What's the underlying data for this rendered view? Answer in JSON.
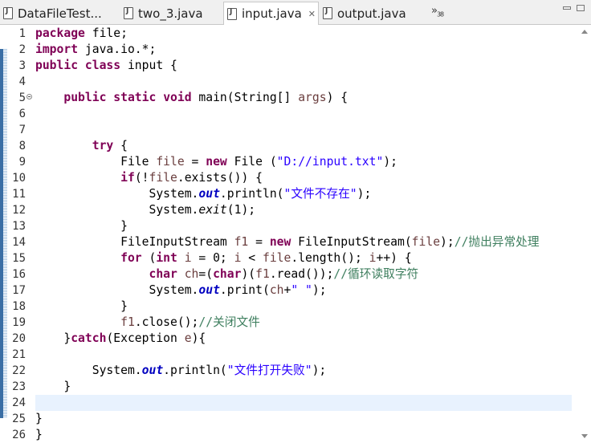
{
  "tabs": [
    {
      "label": "DataFileTest...",
      "active": false
    },
    {
      "label": "two_3.java",
      "active": false
    },
    {
      "label": "input.java",
      "active": true
    },
    {
      "label": "output.java",
      "active": false
    }
  ],
  "overflow": {
    "symbol": "»",
    "count": "38"
  },
  "code_lines": [
    {
      "num": "1",
      "tokens": [
        {
          "t": "package",
          "c": "kw"
        },
        {
          "t": " file;"
        }
      ]
    },
    {
      "num": "2",
      "tokens": [
        {
          "t": "import",
          "c": "kw"
        },
        {
          "t": " java.io.*;"
        }
      ]
    },
    {
      "num": "3",
      "tokens": [
        {
          "t": "public",
          "c": "kw"
        },
        {
          "t": " "
        },
        {
          "t": "class",
          "c": "kw"
        },
        {
          "t": " input {"
        }
      ]
    },
    {
      "num": "4",
      "tokens": []
    },
    {
      "num": "5",
      "fold": true,
      "tokens": [
        {
          "t": "    "
        },
        {
          "t": "public",
          "c": "kw"
        },
        {
          "t": " "
        },
        {
          "t": "static",
          "c": "kw"
        },
        {
          "t": " "
        },
        {
          "t": "void",
          "c": "kw"
        },
        {
          "t": " main(String[] "
        },
        {
          "t": "args",
          "c": "var"
        },
        {
          "t": ") {"
        }
      ]
    },
    {
      "num": "6",
      "tokens": []
    },
    {
      "num": "7",
      "tokens": []
    },
    {
      "num": "8",
      "tokens": [
        {
          "t": "        "
        },
        {
          "t": "try",
          "c": "kw"
        },
        {
          "t": " {"
        }
      ]
    },
    {
      "num": "9",
      "tokens": [
        {
          "t": "            File "
        },
        {
          "t": "file",
          "c": "var"
        },
        {
          "t": " = "
        },
        {
          "t": "new",
          "c": "kw"
        },
        {
          "t": " File ("
        },
        {
          "t": "\"D://input.txt\"",
          "c": "str"
        },
        {
          "t": ");"
        }
      ]
    },
    {
      "num": "10",
      "tokens": [
        {
          "t": "            "
        },
        {
          "t": "if",
          "c": "kw"
        },
        {
          "t": "(!"
        },
        {
          "t": "file",
          "c": "var"
        },
        {
          "t": ".exists()) {"
        }
      ]
    },
    {
      "num": "11",
      "tokens": [
        {
          "t": "                System."
        },
        {
          "t": "out",
          "c": "fld"
        },
        {
          "t": ".println("
        },
        {
          "t": "\"文件不存在\"",
          "c": "str"
        },
        {
          "t": ");"
        }
      ]
    },
    {
      "num": "12",
      "tokens": [
        {
          "t": "                System."
        },
        {
          "t": "exit",
          "c": "ital"
        },
        {
          "t": "(1);"
        }
      ]
    },
    {
      "num": "13",
      "tokens": [
        {
          "t": "            }"
        }
      ]
    },
    {
      "num": "14",
      "tokens": [
        {
          "t": "            FileInputStream "
        },
        {
          "t": "f1",
          "c": "var"
        },
        {
          "t": " = "
        },
        {
          "t": "new",
          "c": "kw"
        },
        {
          "t": " FileInputStream("
        },
        {
          "t": "file",
          "c": "var"
        },
        {
          "t": ");"
        },
        {
          "t": "//抛出异常处理",
          "c": "cmt"
        }
      ]
    },
    {
      "num": "15",
      "tokens": [
        {
          "t": "            "
        },
        {
          "t": "for",
          "c": "kw"
        },
        {
          "t": " ("
        },
        {
          "t": "int",
          "c": "kw"
        },
        {
          "t": " "
        },
        {
          "t": "i",
          "c": "var"
        },
        {
          "t": " = 0; "
        },
        {
          "t": "i",
          "c": "var"
        },
        {
          "t": " < "
        },
        {
          "t": "file",
          "c": "var"
        },
        {
          "t": ".length(); "
        },
        {
          "t": "i",
          "c": "var"
        },
        {
          "t": "++) {"
        }
      ]
    },
    {
      "num": "16",
      "tokens": [
        {
          "t": "                "
        },
        {
          "t": "char",
          "c": "kw"
        },
        {
          "t": " "
        },
        {
          "t": "ch",
          "c": "var"
        },
        {
          "t": "=("
        },
        {
          "t": "char",
          "c": "kw"
        },
        {
          "t": ")("
        },
        {
          "t": "f1",
          "c": "var"
        },
        {
          "t": ".read());"
        },
        {
          "t": "//循环读取字符",
          "c": "cmt"
        }
      ]
    },
    {
      "num": "17",
      "tokens": [
        {
          "t": "                System."
        },
        {
          "t": "out",
          "c": "fld"
        },
        {
          "t": ".print("
        },
        {
          "t": "ch",
          "c": "var"
        },
        {
          "t": "+"
        },
        {
          "t": "\" \"",
          "c": "str"
        },
        {
          "t": ");"
        }
      ]
    },
    {
      "num": "18",
      "tokens": [
        {
          "t": "            }"
        }
      ]
    },
    {
      "num": "19",
      "tokens": [
        {
          "t": "            "
        },
        {
          "t": "f1",
          "c": "var"
        },
        {
          "t": ".close();"
        },
        {
          "t": "//关闭文件",
          "c": "cmt"
        }
      ]
    },
    {
      "num": "20",
      "tokens": [
        {
          "t": "    }"
        },
        {
          "t": "catch",
          "c": "kw"
        },
        {
          "t": "(Exception "
        },
        {
          "t": "e",
          "c": "var"
        },
        {
          "t": "){"
        }
      ]
    },
    {
      "num": "21",
      "tokens": []
    },
    {
      "num": "22",
      "tokens": [
        {
          "t": "        System."
        },
        {
          "t": "out",
          "c": "fld"
        },
        {
          "t": ".println("
        },
        {
          "t": "\"文件打开失败\"",
          "c": "str"
        },
        {
          "t": ");"
        }
      ]
    },
    {
      "num": "23",
      "tokens": [
        {
          "t": "    }"
        }
      ]
    },
    {
      "num": "24",
      "current": true,
      "tokens": []
    },
    {
      "num": "25",
      "tokens": [
        {
          "t": "}"
        }
      ]
    },
    {
      "num": "26",
      "tokens": [
        {
          "t": "}"
        }
      ]
    }
  ]
}
